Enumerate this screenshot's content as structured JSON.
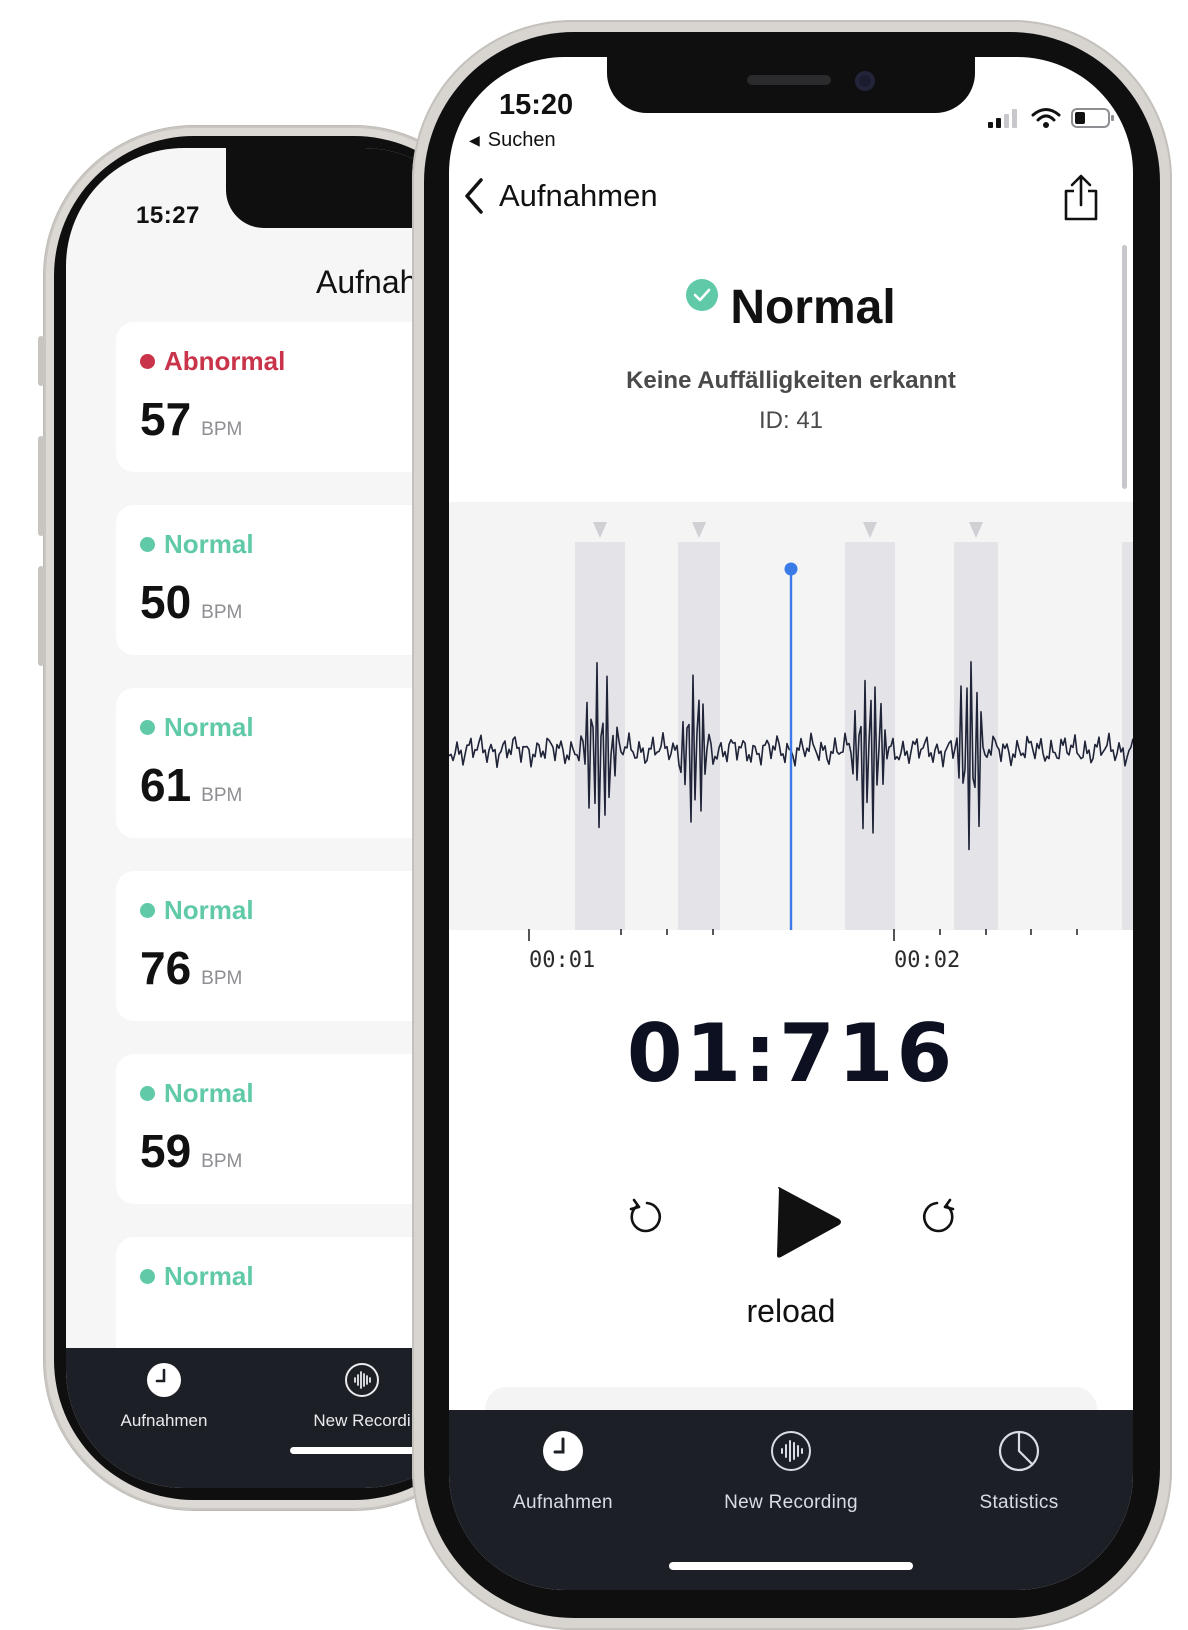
{
  "back_phone": {
    "status_time": "15:27",
    "title": "Aufnahm",
    "recordings": [
      {
        "status": "Abnormal",
        "bpm": "57",
        "unit": "BPM",
        "color": "#c9344a"
      },
      {
        "status": "Normal",
        "bpm": "50",
        "unit": "BPM",
        "color": "#5fc9a8"
      },
      {
        "status": "Normal",
        "bpm": "61",
        "unit": "BPM",
        "color": "#5fc9a8"
      },
      {
        "status": "Normal",
        "bpm": "76",
        "unit": "BPM",
        "color": "#5fc9a8"
      },
      {
        "status": "Normal",
        "bpm": "59",
        "unit": "BPM",
        "color": "#5fc9a8"
      },
      {
        "status": "Normal",
        "bpm": "",
        "unit": "",
        "color": "#5fc9a8"
      }
    ],
    "tabs": [
      {
        "label": "Aufnahmen",
        "icon": "clock-icon"
      },
      {
        "label": "New Recordi",
        "icon": "waveform-icon"
      }
    ]
  },
  "front_phone": {
    "status_time": "15:20",
    "back_app_label": "Suchen",
    "nav": {
      "back_label": "Aufnahmen"
    },
    "result": {
      "label": "Normal",
      "subtitle": "Keine Auffälligkeiten erkannt",
      "id_text": "ID: 41",
      "accent": "#5fc9a8"
    },
    "waveform": {
      "time_labels": [
        "00:01",
        "00:02"
      ],
      "playhead_color": "#3b7be8"
    },
    "timer": "01:716",
    "controls": {
      "reload_label": "reload"
    },
    "tabs": [
      {
        "label": "Aufnahmen",
        "icon": "clock-icon"
      },
      {
        "label": "New Recording",
        "icon": "waveform-icon"
      },
      {
        "label": "Statistics",
        "icon": "pie-chart-icon"
      }
    ]
  }
}
